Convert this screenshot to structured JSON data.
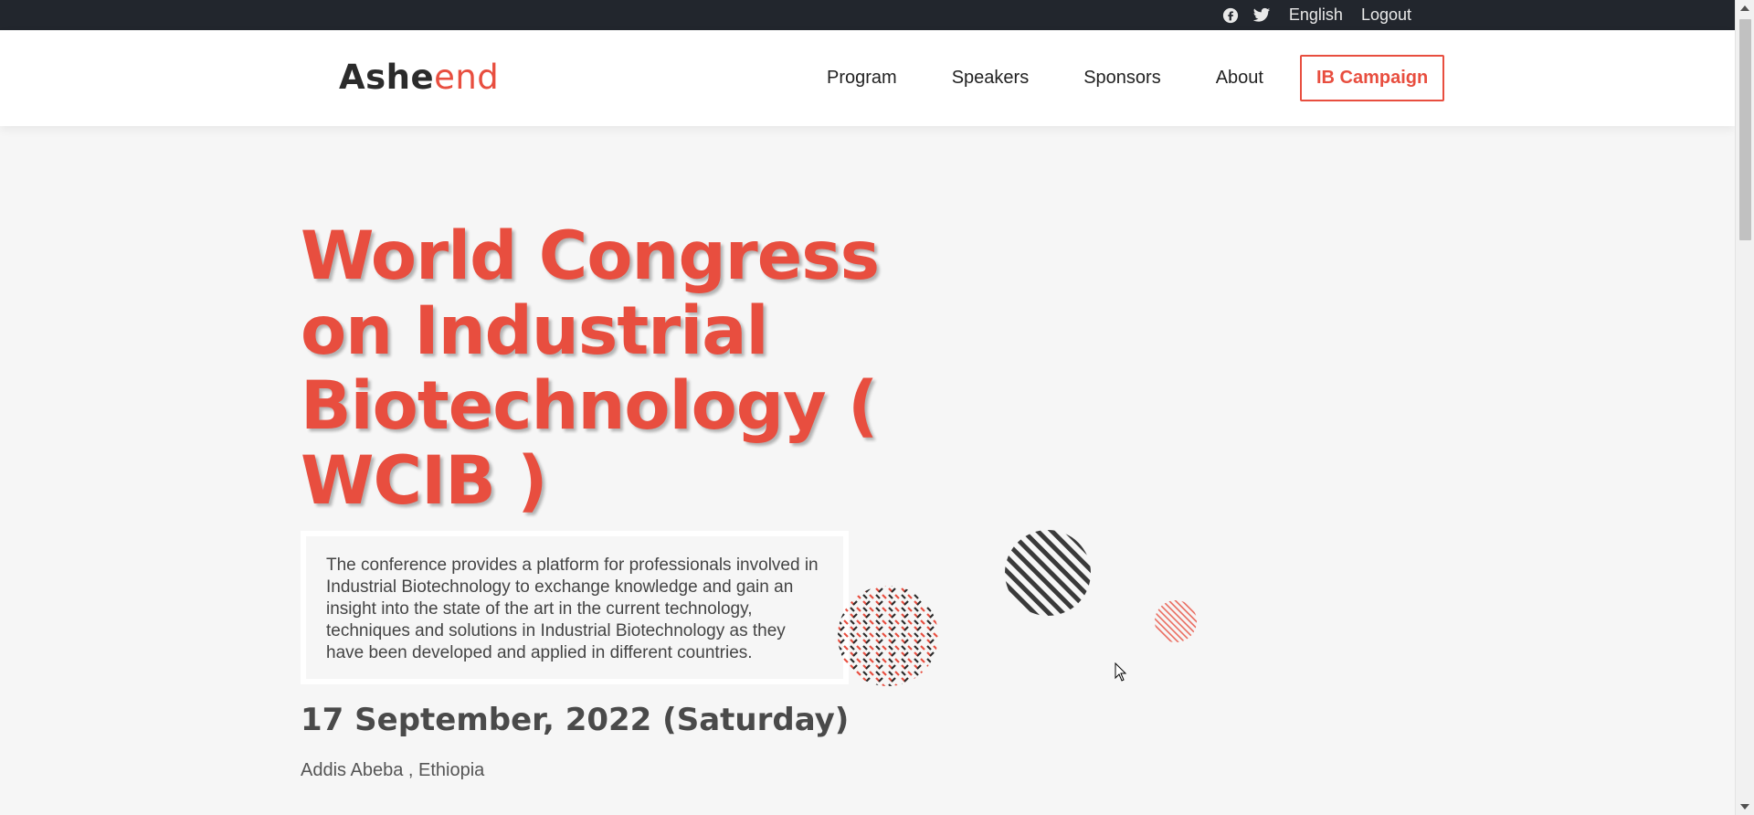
{
  "topbar": {
    "facebook_icon": "facebook-icon",
    "twitter_icon": "twitter-icon",
    "language": "English",
    "logout": "Logout"
  },
  "header": {
    "logo_part1": "Ashe",
    "logo_part2": "end",
    "nav": [
      "Program",
      "Speakers",
      "Sponsors",
      "About"
    ],
    "cta": "IB Campaign"
  },
  "hero": {
    "title": "World Congress on Industrial Biotechnology ( WCIB )",
    "description": "The conference provides a platform for professionals involved in Industrial Biotechnology to exchange knowledge and gain an insight into the state of the art in the current technology, techniques and solutions in Industrial Biotechnology as they have been developed and applied in different countries.",
    "date": "17 September, 2022 (Saturday)",
    "location": "Addis Abeba , Ethiopia"
  },
  "colors": {
    "accent": "#e84e3f",
    "topbar_bg": "#22262d",
    "dark_text": "#2b2b2b"
  }
}
